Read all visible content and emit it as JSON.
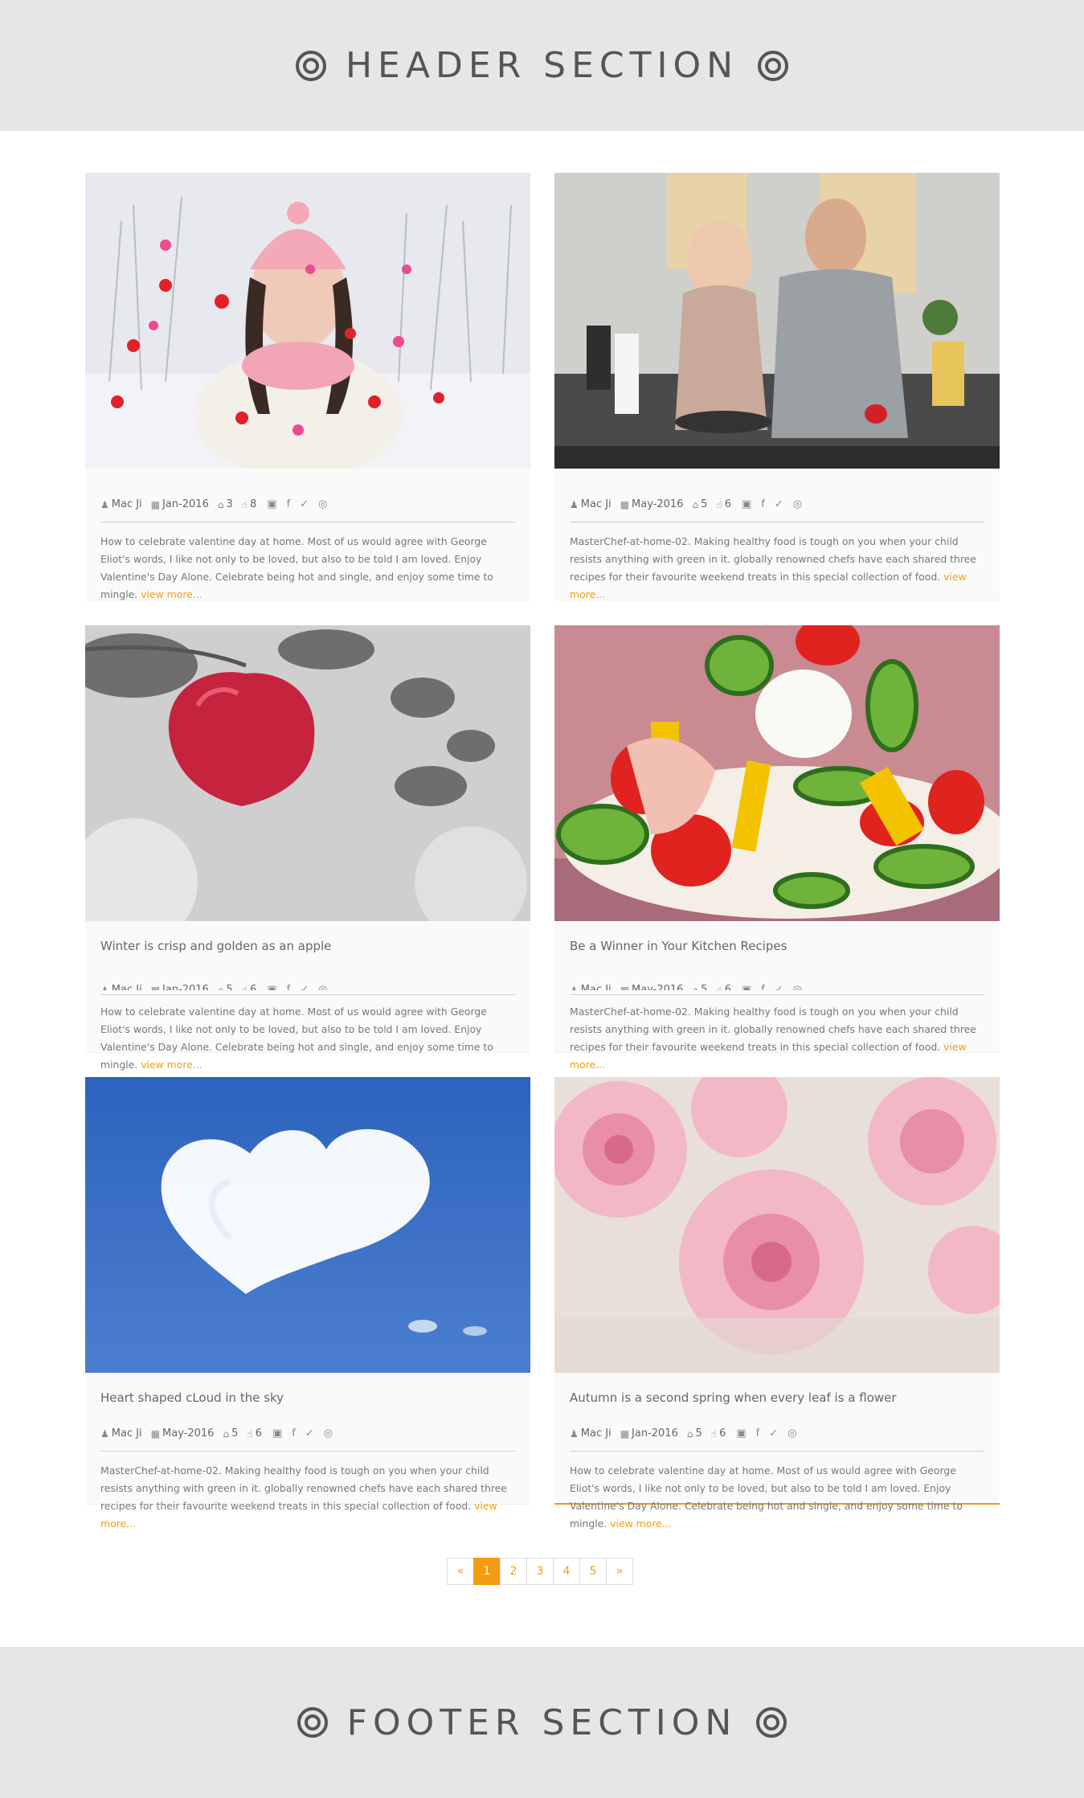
{
  "header": {
    "title": "HEADER SECTION"
  },
  "footer": {
    "title": "FOOTER SECTION"
  },
  "posts": [
    {
      "title": "",
      "author": "Mac Ji",
      "date": "Jan-2016",
      "comments": "3",
      "likes": "8",
      "excerpt": "How to celebrate valentine day at home. Most of us would agree with George Eliot's words, I like not only to be loved, but also to be told I am loved. Enjoy Valentine's Day Alone. Celebrate being hot and single, and enjoy some time to mingle.",
      "more": "view more..."
    },
    {
      "title": "",
      "author": "Mac Ji",
      "date": "May-2016",
      "comments": "5",
      "likes": "6",
      "excerpt": "MasterChef-at-home-02. Making healthy food is tough on you when your child resists anything with green in it. globally renowned chefs have each shared three recipes for their favourite weekend treats in this special collection of food.",
      "more": "view more..."
    },
    {
      "title": "Winter is crisp and golden as an apple",
      "author": "Mac Ji",
      "date": "Jan-2016",
      "comments": "5",
      "likes": "6",
      "excerpt": "How to celebrate valentine day at home. Most of us would agree with George Eliot's words, I like not only to be loved, but also to be told I am loved. Enjoy Valentine's Day Alone. Celebrate being hot and single, and enjoy some time to mingle.",
      "more": "view more..."
    },
    {
      "title": "Be a Winner in Your Kitchen Recipes",
      "author": "Mac Ji",
      "date": "May-2016",
      "comments": "5",
      "likes": "6",
      "excerpt": "MasterChef-at-home-02. Making healthy food is tough on you when your child resists anything with green in it. globally renowned chefs have each shared three recipes for their favourite weekend treats in this special collection of food.",
      "more": "view more..."
    },
    {
      "title": "Heart shaped cLoud in the sky",
      "author": "Mac Ji",
      "date": "May-2016",
      "comments": "5",
      "likes": "6",
      "excerpt": "MasterChef-at-home-02. Making healthy food is tough on you when your child resists anything with green in it. globally renowned chefs have each shared three recipes for their favourite weekend treats in this special collection of food.",
      "more": "view more..."
    },
    {
      "title": "Autumn is a second spring when every leaf is a flower",
      "author": "Mac Ji",
      "date": "Jan-2016",
      "comments": "5",
      "likes": "6",
      "excerpt": "How to celebrate valentine day at home. Most of us would agree with George Eliot's words, I like not only to be loved, but also to be told I am loved. Enjoy Valentine's Day Alone. Celebrate being hot and single, and enjoy some time to mingle.",
      "more": "view more..."
    }
  ],
  "icons": {
    "author": "user-icon",
    "date": "calendar-icon",
    "comments": "comments-icon",
    "likes": "thumbs-up-icon",
    "share": [
      "share-icon",
      "facebook-icon",
      "twitter-icon",
      "pinterest-icon"
    ]
  },
  "pagination": {
    "prev": "«",
    "pages": [
      "1",
      "2",
      "3",
      "4",
      "5"
    ],
    "next": "»",
    "active": "1"
  },
  "colors": {
    "accent": "#f39c12",
    "band": "#e6e6e6",
    "text": "#777777"
  }
}
